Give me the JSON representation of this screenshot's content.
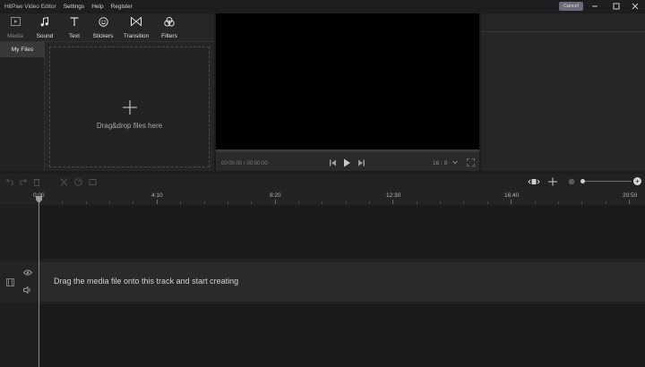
{
  "titlebar": {
    "title": "HitPaw Video Editor",
    "menu": [
      "Settings",
      "Help",
      "Register"
    ],
    "cancel_label": "Cancel"
  },
  "tools": [
    {
      "label": "Media",
      "icon": "media-icon"
    },
    {
      "label": "Sound",
      "icon": "music-note-icon"
    },
    {
      "label": "Text",
      "icon": "text-icon"
    },
    {
      "label": "Stickers",
      "icon": "sticker-icon"
    },
    {
      "label": "Transition",
      "icon": "transition-icon"
    },
    {
      "label": "Filters",
      "icon": "filters-icon"
    }
  ],
  "sidebar": {
    "my_files": "My Files"
  },
  "media": {
    "drop_text": "Drag&drop files here"
  },
  "preview": {
    "time": "00:00:00 / 00:00:00",
    "aspect": "16 : 9"
  },
  "timeline": {
    "ruler": [
      "0:00",
      "4:10",
      "8:20",
      "12:30",
      "16:40",
      "20:50"
    ],
    "track_hint": "Drag the media file onto this track and start creating"
  },
  "colors": {
    "background": "#1c1c1e",
    "panel": "#262628",
    "accent_cancel": "#6f6a7b"
  }
}
